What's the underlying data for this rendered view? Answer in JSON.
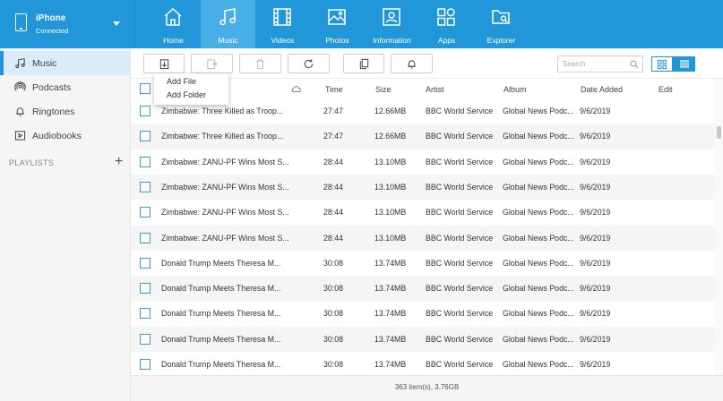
{
  "device": {
    "name": "iPhone",
    "status": "Connected"
  },
  "nav": [
    {
      "label": "Home",
      "icon": "home-icon"
    },
    {
      "label": "Music",
      "icon": "music-icon",
      "active": true
    },
    {
      "label": "Videos",
      "icon": "film-icon"
    },
    {
      "label": "Photos",
      "icon": "image-icon"
    },
    {
      "label": "Information",
      "icon": "contact-card-icon"
    },
    {
      "label": "Apps",
      "icon": "apps-grid-icon"
    },
    {
      "label": "Explorer",
      "icon": "folder-search-icon"
    }
  ],
  "sidebar": {
    "items": [
      {
        "label": "Music",
        "icon": "music-note-icon",
        "active": true
      },
      {
        "label": "Podcasts",
        "icon": "podcast-icon"
      },
      {
        "label": "Ringtones",
        "icon": "bell-icon"
      },
      {
        "label": "Audiobooks",
        "icon": "audiobook-icon"
      }
    ],
    "playlists_label": "PLAYLISTS",
    "add_symbol": "+"
  },
  "toolbar": {
    "search_placeholder": "Search",
    "buttons": [
      "import-icon",
      "export-icon",
      "trash-icon",
      "refresh-icon",
      "copy-to-device-icon",
      "ringtone-bell-icon"
    ]
  },
  "dropdown": {
    "items": [
      "Add File",
      "Add Folder"
    ]
  },
  "table": {
    "columns": [
      "Time",
      "Size",
      "Artist",
      "Album",
      "Date Added",
      "Edit"
    ],
    "rows": [
      {
        "name": "Zimbabwe: Three Killed as Troop...",
        "time": "27:47",
        "size": "12.66MB",
        "artist": "BBC World Service",
        "album": "Global News Podc...",
        "date": "9/6/2019"
      },
      {
        "name": "Zimbabwe: Three Killed as Troop...",
        "time": "27:47",
        "size": "12.66MB",
        "artist": "BBC World Service",
        "album": "Global News Podc...",
        "date": "9/6/2019"
      },
      {
        "name": "Zimbabwe: ZANU-PF Wins Most S...",
        "time": "28:44",
        "size": "13.10MB",
        "artist": "BBC World Service",
        "album": "Global News Podc...",
        "date": "9/6/2019"
      },
      {
        "name": "Zimbabwe: ZANU-PF Wins Most S...",
        "time": "28:44",
        "size": "13.10MB",
        "artist": "BBC World Service",
        "album": "Global News Podc...",
        "date": "9/6/2019"
      },
      {
        "name": "Zimbabwe: ZANU-PF Wins Most S...",
        "time": "28:44",
        "size": "13.10MB",
        "artist": "BBC World Service",
        "album": "Global News Podc...",
        "date": "9/6/2019"
      },
      {
        "name": "Zimbabwe: ZANU-PF Wins Most S...",
        "time": "28:44",
        "size": "13.10MB",
        "artist": "BBC World Service",
        "album": "Global News Podc...",
        "date": "9/6/2019"
      },
      {
        "name": "Donald Trump Meets Theresa M...",
        "time": "30:08",
        "size": "13.74MB",
        "artist": "BBC World Service",
        "album": "Global News Podc...",
        "date": "9/6/2019"
      },
      {
        "name": "Donald Trump Meets Theresa M...",
        "time": "30:08",
        "size": "13.74MB",
        "artist": "BBC World Service",
        "album": "Global News Podc...",
        "date": "9/6/2019"
      },
      {
        "name": "Donald Trump Meets Theresa M...",
        "time": "30:08",
        "size": "13.74MB",
        "artist": "BBC World Service",
        "album": "Global News Podc...",
        "date": "9/6/2019"
      },
      {
        "name": "Donald Trump Meets Theresa M...",
        "time": "30:08",
        "size": "13.74MB",
        "artist": "BBC World Service",
        "album": "Global News Podc...",
        "date": "9/6/2019"
      },
      {
        "name": "Donald Trump Meets Theresa M...",
        "time": "30:08",
        "size": "13.74MB",
        "artist": "BBC World Service",
        "album": "Global News Podc...",
        "date": "9/6/2019"
      }
    ]
  },
  "footer": {
    "summary": "363 item(s), 3.76GB"
  },
  "colors": {
    "accent": "#2196d8",
    "active_nav": "#47aee6",
    "sidebar_active": "#d9ecf8"
  }
}
